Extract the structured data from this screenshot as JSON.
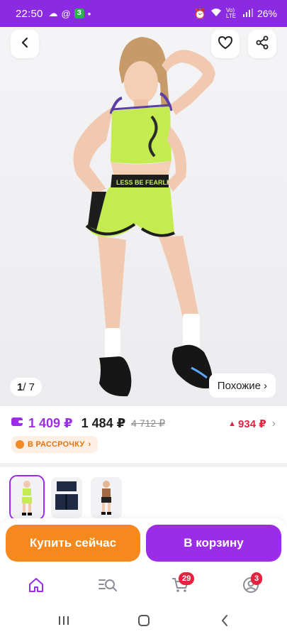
{
  "status_bar": {
    "time": "22:50",
    "app_badge": "З",
    "lte": "Vo) LTE",
    "battery": "26%"
  },
  "gallery": {
    "counter_current": "1",
    "counter_total": "/ 7",
    "similar_label": "Похожие",
    "shorts_print": "LESS BE FEARLESS"
  },
  "price": {
    "wallet_price": "1 409 ₽",
    "current_price": "1 484 ₽",
    "old_price": "4 712 ₽",
    "diff": "934 ₽",
    "installment_label": "В РАССРОЧКУ"
  },
  "thumbnails": [
    {
      "name": "green set",
      "selected": true
    },
    {
      "name": "navy set",
      "selected": false
    },
    {
      "name": "brown set",
      "selected": false
    }
  ],
  "actions": {
    "buy_now": "Купить сейчас",
    "add_to_cart": "В корзину"
  },
  "bottom_nav": {
    "cart_badge": "29",
    "profile_badge": "3"
  },
  "colors": {
    "brand_purple": "#9b2de8",
    "status_purple": "#8a2be2",
    "buy_orange": "#f5891e",
    "price_red": "#e5223f"
  }
}
